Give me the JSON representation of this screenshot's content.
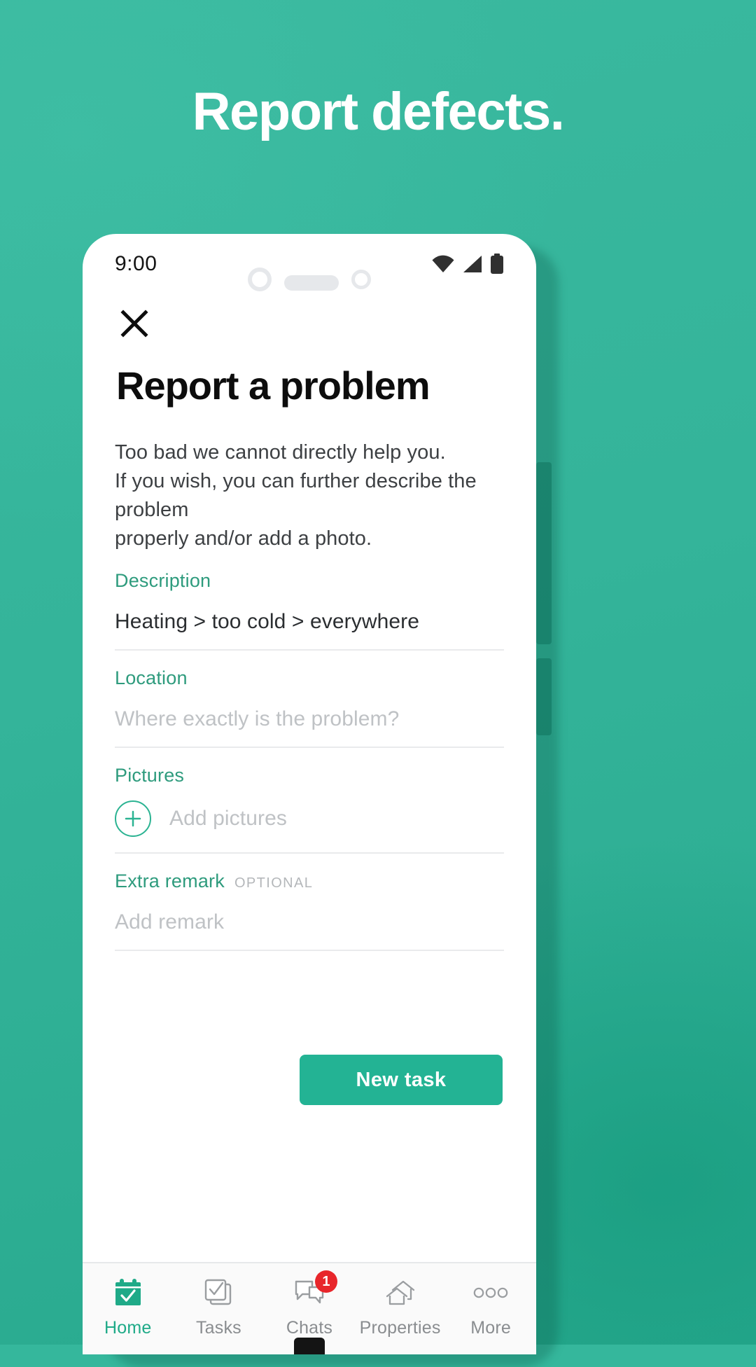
{
  "theme": {
    "brand_green": "#35b79c",
    "accent_green": "#2e9b7d",
    "button_green": "#23b394",
    "badge_red": "#e8262b"
  },
  "headline": "Report defects.",
  "phone": {
    "statusbar": {
      "time": "9:00",
      "icons": [
        "wifi-icon",
        "signal-icon",
        "battery-icon"
      ]
    },
    "screen": {
      "close_label": "close-icon",
      "title": "Report a problem",
      "intro_lines": [
        "Too bad we cannot directly help you.",
        "If you wish, you can further describe the problem",
        "properly and/or add a photo."
      ],
      "fields": [
        {
          "label": "Description",
          "optional": "",
          "value": "Heating > too cold > everywhere",
          "placeholder": ""
        },
        {
          "label": "Location",
          "optional": "",
          "value": "",
          "placeholder": "Where exactly is the problem?"
        },
        {
          "label": "Pictures",
          "optional": "",
          "value": "",
          "placeholder": "Add pictures"
        },
        {
          "label": "Extra remark",
          "optional": "OPTIONAL",
          "value": "",
          "placeholder": "Add remark"
        }
      ],
      "primary_button": "New task"
    },
    "bottom_nav": [
      {
        "label": "Home",
        "icon": "calendar-check-icon",
        "badge": "",
        "active": true
      },
      {
        "label": "Tasks",
        "icon": "tasks-icon",
        "badge": "",
        "active": false
      },
      {
        "label": "Chats",
        "icon": "chat-bubbles-icon",
        "badge": "1",
        "active": false
      },
      {
        "label": "Properties",
        "icon": "houses-icon",
        "badge": "",
        "active": false
      },
      {
        "label": "More",
        "icon": "more-dots-icon",
        "badge": "",
        "active": false
      }
    ]
  }
}
